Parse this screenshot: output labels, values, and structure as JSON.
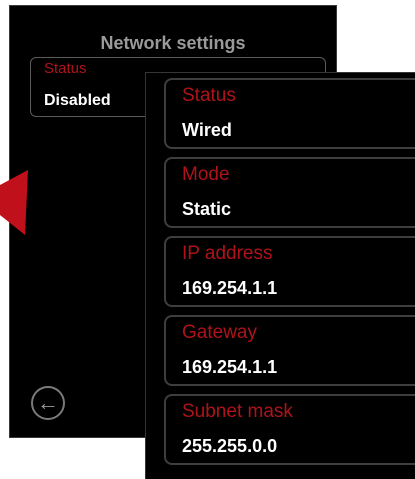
{
  "back_panel": {
    "title": "Network settings",
    "status": {
      "label": "Status",
      "value": "Disabled"
    }
  },
  "front_panel": {
    "fields": [
      {
        "label": "Status",
        "value": "Wired"
      },
      {
        "label": "Mode",
        "value": "Static"
      },
      {
        "label": "IP address",
        "value": "169.254.1.1"
      },
      {
        "label": "Gateway",
        "value": "169.254.1.1"
      },
      {
        "label": "Subnet mask",
        "value": "255.255.0.0"
      }
    ]
  },
  "colors": {
    "background": "#000000",
    "label_red": "#b0121a",
    "value_white": "#ffffff",
    "title_gray": "#9a9a9a",
    "arrow_red": "#c0101c"
  },
  "icons": {
    "back": "arrow-left-circle-icon",
    "pointer": "red-arrow-icon"
  }
}
